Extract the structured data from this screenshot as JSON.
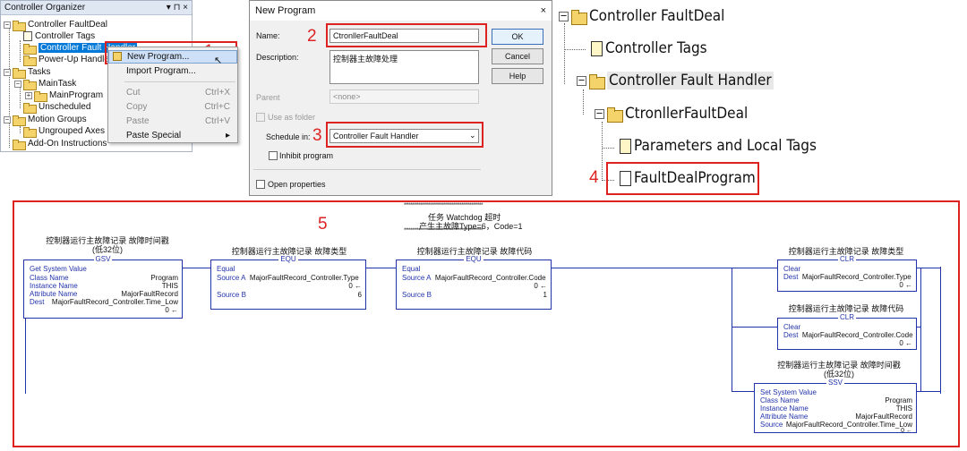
{
  "organizer": {
    "title": "Controller Organizer",
    "header_icons": "▾ ⊓ ×",
    "items": [
      {
        "label": "Controller FaultDeal"
      },
      {
        "label": "Controller Tags"
      },
      {
        "label": "Controller Fault Handler"
      },
      {
        "label": "Power-Up Handler"
      },
      {
        "label": "Tasks"
      },
      {
        "label": "MainTask"
      },
      {
        "label": "MainProgram"
      },
      {
        "label": "Unscheduled"
      },
      {
        "label": "Motion Groups"
      },
      {
        "label": "Ungrouped Axes"
      },
      {
        "label": "Add-On Instructions"
      }
    ]
  },
  "context_menu": {
    "items": [
      {
        "label": "New Program...",
        "shortcut": ""
      },
      {
        "label": "Import Program...",
        "shortcut": ""
      },
      {
        "label": "Cut",
        "shortcut": "Ctrl+X"
      },
      {
        "label": "Copy",
        "shortcut": "Ctrl+C"
      },
      {
        "label": "Paste",
        "shortcut": "Ctrl+V"
      },
      {
        "label": "Paste Special",
        "shortcut": "▸"
      }
    ]
  },
  "dialog": {
    "title": "New Program",
    "close": "×",
    "name_label": "Name:",
    "name_value": "CtronllerFaultDeal",
    "description_label": "Description:",
    "description_value": "控制器主故障处理",
    "parent_label": "Parent",
    "parent_value": "<none>",
    "use_as_folder_label": "Use as folder",
    "schedule_label": "Schedule in:",
    "schedule_value": "Controller Fault Handler",
    "inhibit_label": "Inhibit program",
    "open_properties_label": "Open properties",
    "ok": "OK",
    "cancel": "Cancel",
    "help": "Help"
  },
  "big_tree": {
    "items": [
      {
        "label": "Controller FaultDeal"
      },
      {
        "label": "Controller Tags"
      },
      {
        "label": "Controller Fault Handler"
      },
      {
        "label": "CtronllerFaultDeal"
      },
      {
        "label": "Parameters and Local Tags"
      },
      {
        "label": "FaultDealProgram"
      }
    ]
  },
  "steps": [
    "1",
    "2",
    "3",
    "4",
    "5"
  ],
  "ladder": {
    "header_stars": "************************************************",
    "header_line1": "任务 Watchdog 超时",
    "header_line2": "产生主故障Type=6，Code=1",
    "gsv": {
      "comment1": "控制器运行主故障记录 故障时间戳",
      "comment2": "(低32位)",
      "mnemonic": "GSV",
      "name": "Get System Value",
      "rows": [
        {
          "k": "Class Name",
          "v": "Program"
        },
        {
          "k": "Instance Name",
          "v": "THIS"
        },
        {
          "k": "Attribute Name",
          "v": "MajorFaultRecord"
        },
        {
          "k": "Dest",
          "v": "MajorFaultRecord_Controller.Time_Low"
        }
      ],
      "dest_val": "0 ←"
    },
    "equ1": {
      "comment": "控制器运行主故障记录 故障类型",
      "mnemonic": "EQU",
      "name": "Equal",
      "source_a_label": "Source A",
      "source_a": "MajorFaultRecord_Controller.Type",
      "source_a_val": "0 ←",
      "source_b_label": "Source B",
      "source_b": "6"
    },
    "equ2": {
      "comment": "控制器运行主故障记录 故障代码",
      "mnemonic": "EQU",
      "name": "Equal",
      "source_a_label": "Source A",
      "source_a": "MajorFaultRecord_Controller.Code",
      "source_a_val": "0 ←",
      "source_b_label": "Source B",
      "source_b": "1"
    },
    "clr1": {
      "comment": "控制器运行主故障记录 故障类型",
      "mnemonic": "CLR",
      "name": "Clear",
      "dest_label": "Dest",
      "dest": "MajorFaultRecord_Controller.Type",
      "dest_val": "0 ←"
    },
    "clr2": {
      "comment": "控制器运行主故障记录 故障代码",
      "mnemonic": "CLR",
      "name": "Clear",
      "dest_label": "Dest",
      "dest": "MajorFaultRecord_Controller.Code",
      "dest_val": "0 ←"
    },
    "ssv": {
      "comment1": "控制器运行主故障记录 故障时间戳",
      "comment2": "(低32位)",
      "mnemonic": "SSV",
      "name": "Set System Value",
      "rows": [
        {
          "k": "Class Name",
          "v": "Program"
        },
        {
          "k": "Instance Name",
          "v": "THIS"
        },
        {
          "k": "Attribute Name",
          "v": "MajorFaultRecord"
        },
        {
          "k": "Source",
          "v": "MajorFaultRecord_Controller.Time_Low"
        }
      ],
      "source_val": "0 ←"
    }
  },
  "colors": {
    "highlight_red": "#dd2222",
    "instruction_blue": "#2233aa",
    "selection_blue": "#0078d7"
  }
}
